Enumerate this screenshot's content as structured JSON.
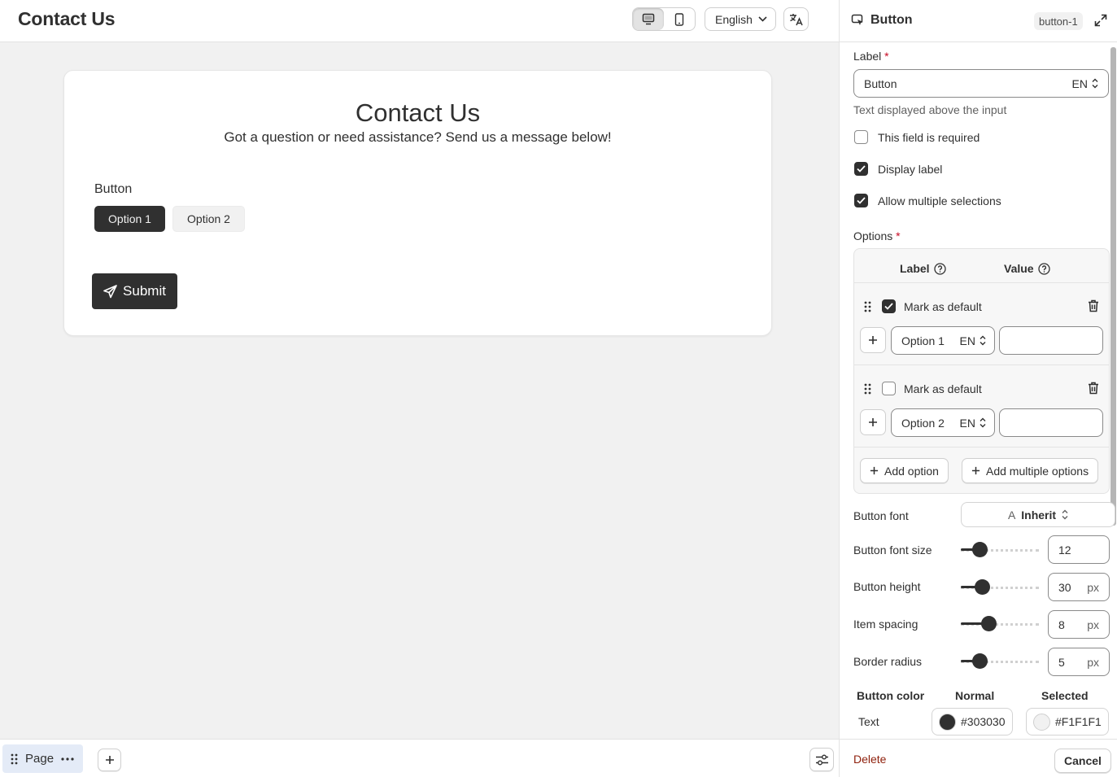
{
  "topbar": {
    "title": "Contact Us",
    "language": "English",
    "device_options": [
      "desktop-icon",
      "mobile-icon"
    ],
    "active_device": "desktop"
  },
  "form": {
    "title": "Contact Us",
    "subtitle": "Got a question or need assistance? Send us a message below!",
    "field_label": "Button",
    "options": [
      {
        "label": "Option 1",
        "selected": true
      },
      {
        "label": "Option 2",
        "selected": false
      }
    ],
    "submit_label": "Submit"
  },
  "bottombar": {
    "page_label": "Page"
  },
  "panel": {
    "title": "Button",
    "element_id": "button-1",
    "label_field": {
      "label": "Label",
      "value": "Button",
      "lang": "EN",
      "help": "Text displayed above the input"
    },
    "checkboxes": [
      {
        "label": "This field is required",
        "checked": false
      },
      {
        "label": "Display label",
        "checked": true
      },
      {
        "label": "Allow multiple selections",
        "checked": true
      }
    ],
    "options_section": {
      "label": "Options",
      "col_label": "Label",
      "col_value": "Value",
      "items": [
        {
          "default_label": "Mark as default",
          "is_default": true,
          "label": "Option 1",
          "lang": "EN",
          "value": ""
        },
        {
          "default_label": "Mark as default",
          "is_default": false,
          "label": "Option 2",
          "lang": "EN",
          "value": ""
        }
      ],
      "add_option": "Add option",
      "add_multiple": "Add multiple options"
    },
    "button_font": {
      "label": "Button font",
      "value": "Inherit"
    },
    "sliders": [
      {
        "label": "Button font size",
        "value": "12",
        "unit": "",
        "level": 0.18
      },
      {
        "label": "Button height",
        "value": "30",
        "unit": "px",
        "level": 0.22
      },
      {
        "label": "Item spacing",
        "value": "8",
        "unit": "px",
        "level": 0.32
      },
      {
        "label": "Border radius",
        "value": "5",
        "unit": "px",
        "level": 0.18
      }
    ],
    "button_color": {
      "heading": "Button color",
      "normal_heading": "Normal",
      "selected_heading": "Selected",
      "rows": [
        {
          "label": "Text",
          "normal": "#303030",
          "selected": "#F1F1F1"
        }
      ]
    },
    "footer": {
      "delete": "Delete",
      "cancel": "Cancel"
    }
  },
  "colors": {
    "dark": "#303030",
    "light": "#F1F1F1",
    "danger": "#8e1f0b",
    "page_chip": "#e4ebf7"
  }
}
